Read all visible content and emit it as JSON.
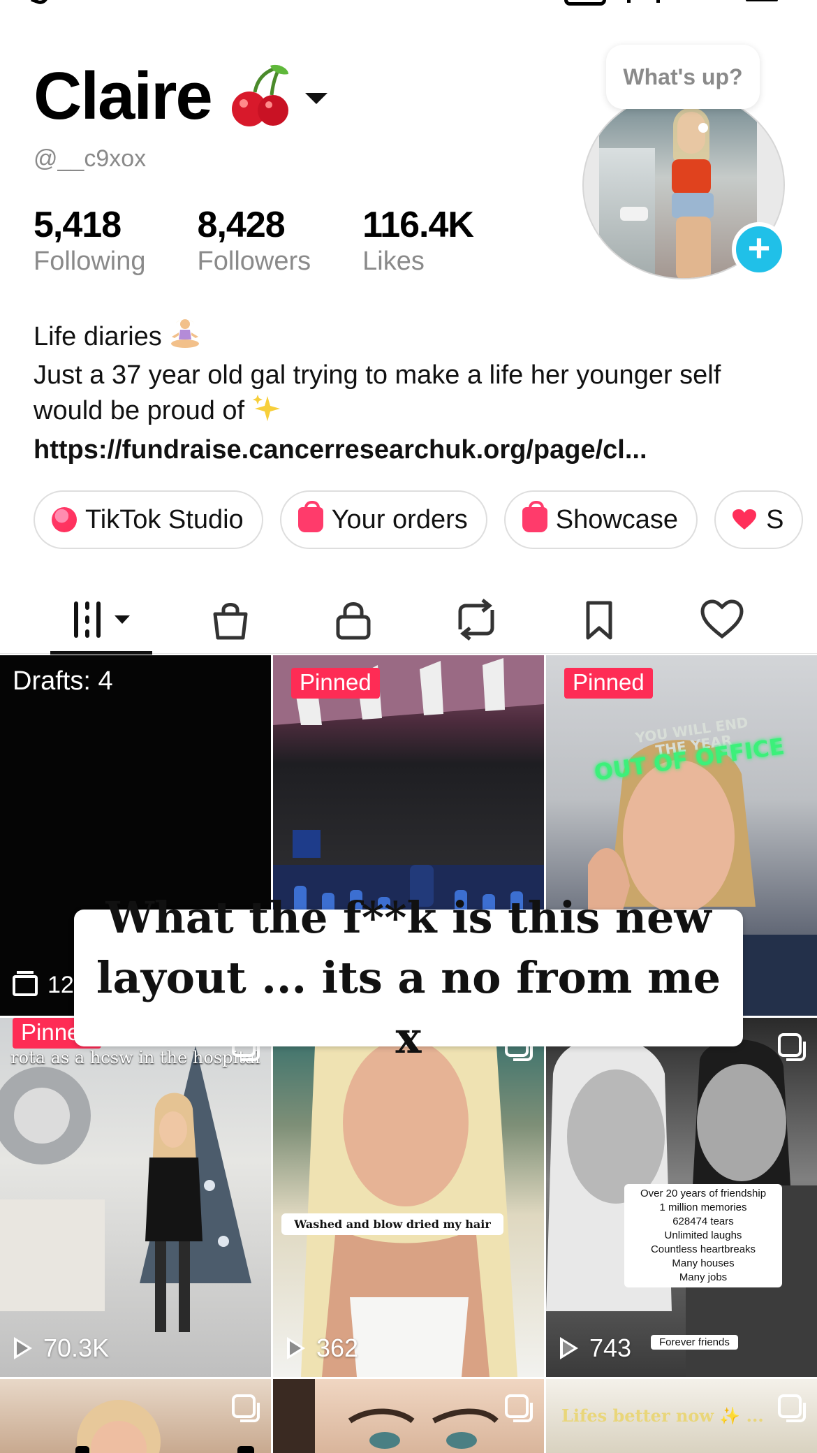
{
  "profile": {
    "name": "Claire",
    "handle": "@__c9xox",
    "avatar_bubble": "What's up?",
    "stats": [
      {
        "value": "5,418",
        "label": "Following"
      },
      {
        "value": "8,428",
        "label": "Followers"
      },
      {
        "value": "116.4K",
        "label": "Likes"
      }
    ],
    "bio_line1": "Life diaries",
    "bio_line2": "Just a 37 year old gal trying to make a life her younger self would be proud of",
    "bio_link": "https://fundraise.cancerresearchuk.org/page/cl..."
  },
  "chips": [
    {
      "label": "TikTok Studio",
      "icon": "studio-icon"
    },
    {
      "label": "Your orders",
      "icon": "orders-bag-icon"
    },
    {
      "label": "Showcase",
      "icon": "showcase-bag-icon"
    },
    {
      "label": "S",
      "icon": "heart-icon"
    }
  ],
  "tabs": [
    {
      "icon": "videos-grid-icon",
      "active": true
    },
    {
      "icon": "shop-bag-icon"
    },
    {
      "icon": "lock-icon"
    },
    {
      "icon": "repost-icon"
    },
    {
      "icon": "bookmark-icon"
    },
    {
      "icon": "heart-outline-icon"
    }
  ],
  "grid": {
    "drafts_label": "Drafts: 4",
    "drafts_count": "12",
    "pinned_label": "Pinned",
    "video3_text_top": "YOU WILL END THE YEAR",
    "video3_text_green": "OUT OF OFFICE",
    "video4_caption": "rota as a hcsw in the hospital",
    "video4_views": "70.3K",
    "video5_caption": "Washed and blow dried my hair",
    "video5_views": "362",
    "video6_caption": "Over 20 years of friendship\n1 million memories\n628474 tears\nUnlimited laughs\nCountless heartbreaks\nMany houses\nMany jobs",
    "video6_caption2": "Forever friends",
    "video6_views": "743",
    "video9_caption": "Lifes better now ✨ ..."
  },
  "overlay_text": "What the f**k is this new layout ... its a no from me x",
  "colors": {
    "pinned": "#fe2c55",
    "plus_button": "#20c0e8",
    "chip_icon": "#ff3b6b",
    "muted_text": "#8a8a8a"
  }
}
